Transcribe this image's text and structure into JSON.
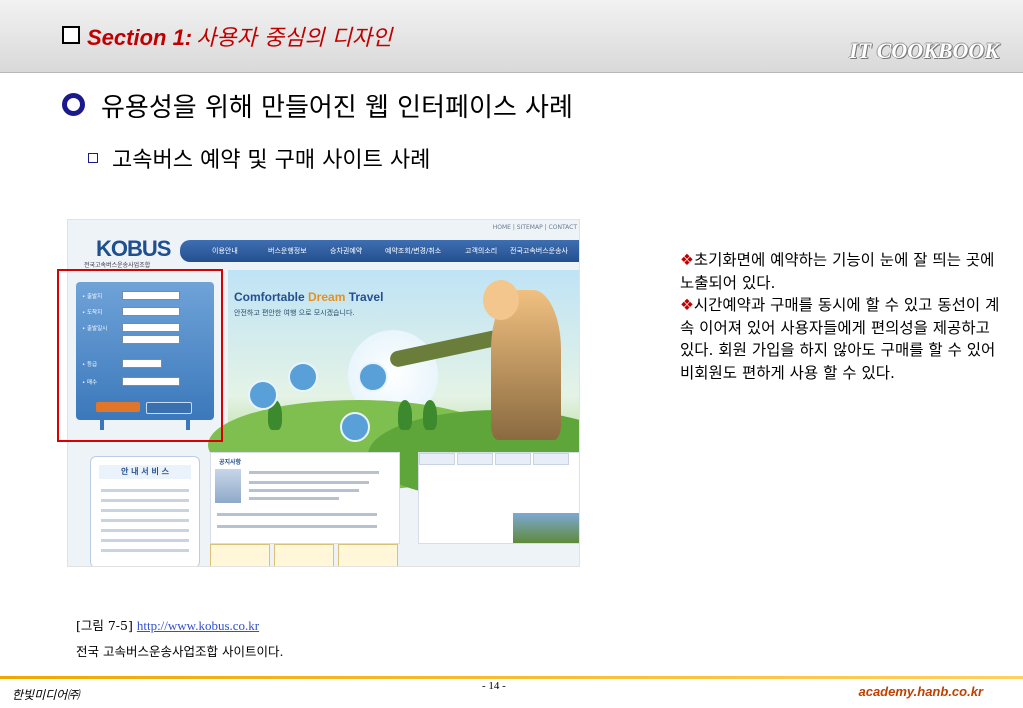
{
  "header": {
    "section_label": "Section 1:",
    "section_title": "사용자 중심의 디자인",
    "brand": "IT COOKBOOK"
  },
  "headings": {
    "h1": "유용성을 위해 만들어진 웹 인터페이스 사례",
    "h2": "고속버스 예약 및 구매 사이트 사례"
  },
  "screenshot": {
    "topnav": "HOME | SITEMAP | CONTACT",
    "logo": "KOBUS",
    "logo_sub": "전국고속버스운송사업조합",
    "menu": [
      "이용안내",
      "버스운행정보",
      "승차권예약",
      "예약조회/변경/취소",
      "고객의소리",
      "전국고속버스운송사"
    ],
    "hero_title_a": "Comfortable ",
    "hero_title_b": "Dream",
    "hero_title_c": " Travel",
    "hero_sub": "안전하고 편안한 여행 으로 모시겠습니다.",
    "booking_rows": [
      "• 출발지",
      "• 도착지",
      "• 출발일시",
      "",
      "• 등급",
      "• 매수"
    ],
    "service_title": "안 내 서 비 스",
    "notice_title": "공지사항"
  },
  "notes": {
    "bullet1": "초기화면에 예약하는 기능이 눈에 잘 띄는 곳에 노출되어 있다.",
    "bullet2": "시간예약과 구매를 동시에 할 수 있고 동선이 계속 이어져 있어 사용자들에게 편의성을 제공하고 있다. 회원 가입을 하지 않아도 구매를 할 수 있어 비회원도 편하게 사용 할 수 있다."
  },
  "caption": {
    "label": "[그림 7-5] ",
    "link": "http://www.kobus.co.kr",
    "text": "전국 고속버스운송사업조합 사이트이다."
  },
  "footer": {
    "publisher": "한빛미디어㈜",
    "page": "- 14 -",
    "site": "academy.hanb.co.kr"
  },
  "colors": {
    "accent_red": "#c00000",
    "navy": "#1a1a8c",
    "footer_orange": "#f0a800",
    "site_red": "#c04000"
  }
}
